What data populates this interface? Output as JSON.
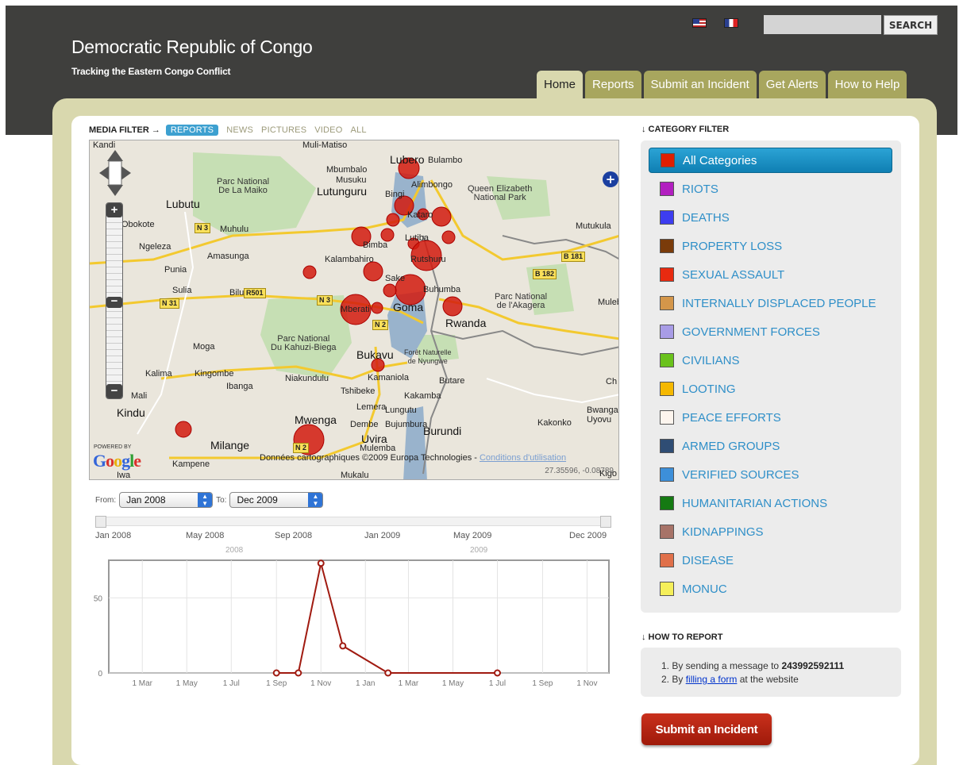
{
  "header": {
    "title": "Democratic Republic of Congo",
    "tagline": "Tracking the Eastern Congo Conflict",
    "flags": [
      "us-flag-icon",
      "france-flag-icon"
    ],
    "search_placeholder": "",
    "search_button": "SEARCH"
  },
  "nav": {
    "tabs": [
      {
        "label": "Home",
        "active": true
      },
      {
        "label": "Reports",
        "active": false
      },
      {
        "label": "Submit an Incident",
        "active": false
      },
      {
        "label": "Get Alerts",
        "active": false
      },
      {
        "label": "How to Help",
        "active": false
      }
    ]
  },
  "media_filter": {
    "label": "MEDIA FILTER →",
    "items": [
      "REPORTS",
      "NEWS",
      "PICTURES",
      "VIDEO",
      "ALL"
    ],
    "active": "REPORTS"
  },
  "map": {
    "places": [
      "Kandi",
      "Muli-Matiso",
      "Lubero",
      "Bulambo",
      "Mbumbalo",
      "Musuku",
      "Alimbongo",
      "Lutunguru",
      "Bingi",
      "Lubutu",
      "Obokote",
      "Muhulu",
      "Kataro",
      "Ngeleza",
      "Amasunga",
      "Lutiba",
      "Bimba",
      "Rutshuru",
      "Mutukula",
      "Kalambahiro",
      "Punia",
      "Sake",
      "Buhumba",
      "Sulia",
      "Bilu",
      "Mberati",
      "Goma",
      "Rwanda",
      "Moga",
      "Bukavu",
      "Kalima",
      "Kingombe",
      "Niakundulu",
      "Kamaniola",
      "Butare",
      "Ibanga",
      "Tshibeke",
      "Kakamba",
      "Mali",
      "Lemera",
      "Lungutu",
      "Kindu",
      "Mwenga",
      "Dembe",
      "Bujumbura",
      "Burundi",
      "Kakonko",
      "Bwanga",
      "Uyovu",
      "Milange",
      "Uvira",
      "Kampene",
      "Mukalu",
      "Mulemba",
      "Muleb",
      "Iwa",
      "Kigo",
      "Ch"
    ],
    "parks": [
      "Parc National\nDe La Maiko",
      "Queen Elizabeth\nNational Park",
      "Parc National\nDu Kahuzi-Biega",
      "Parc National\nde l'Akagera",
      "Forêt Naturelle\nde Nyungwe"
    ],
    "roads": [
      "N 3",
      "N 31",
      "R501",
      "N 3",
      "N 2",
      "N 2",
      "B 181",
      "B 182"
    ],
    "powered_by": "POWERED BY",
    "google_logo": "Google",
    "attribution": "Données cartographiques ©2009 Europa Technologies -",
    "conditions_link": "Conditions d'utilisation",
    "coordinates": "27.35596, -0.08789",
    "incident_color": "#d21a0e"
  },
  "timeline": {
    "from_label": "From:",
    "to_label": "To:",
    "from_value": "Jan 2008",
    "to_value": "Dec 2009",
    "slider_labels": [
      "Jan 2008",
      "May 2008",
      "Sep 2008",
      "Jan 2009",
      "May 2009",
      "Dec 2009"
    ],
    "year_labels": [
      "2008",
      "2009"
    ]
  },
  "chart_data": {
    "type": "line",
    "title": "",
    "xlabel": "",
    "ylabel": "",
    "x_tick_labels": [
      "1 Mar",
      "1 May",
      "1 Jul",
      "1 Sep",
      "1 Nov",
      "1 Jan",
      "1 Mar",
      "1 May",
      "1 Jul",
      "1 Sep",
      "1 Nov"
    ],
    "y_ticks": [
      0,
      50
    ],
    "ylim": [
      0,
      75
    ],
    "series": [
      {
        "color": "#a01a10",
        "points": [
          {
            "x": "2008-09-01",
            "y": 0
          },
          {
            "x": "2008-10-01",
            "y": 0
          },
          {
            "x": "2008-11-01",
            "y": 73
          },
          {
            "x": "2008-12-01",
            "y": 18
          },
          {
            "x": "2009-02-01",
            "y": 0
          },
          {
            "x": "2009-07-01",
            "y": 0
          }
        ]
      }
    ]
  },
  "category_filter": {
    "heading": "↓ CATEGORY FILTER",
    "items": [
      {
        "label": "All Categories",
        "color": "#e01e00",
        "active": true
      },
      {
        "label": "RIOTS",
        "color": "#b21fc0"
      },
      {
        "label": "DEATHS",
        "color": "#3d3df0"
      },
      {
        "label": "PROPERTY LOSS",
        "color": "#7a3b0a"
      },
      {
        "label": "SEXUAL ASSAULT",
        "color": "#e82a10"
      },
      {
        "label": "INTERNALLY DISPLACED PEOPLE",
        "color": "#d4964a"
      },
      {
        "label": "GOVERNMENT FORCES",
        "color": "#a89ce6"
      },
      {
        "label": "CIVILIANS",
        "color": "#6ac21c"
      },
      {
        "label": "LOOTING",
        "color": "#f5b800"
      },
      {
        "label": "PEACE EFFORTS",
        "color": "#fdf5ee"
      },
      {
        "label": "ARMED GROUPS",
        "color": "#2f4d74"
      },
      {
        "label": "VERIFIED SOURCES",
        "color": "#3d8fd9"
      },
      {
        "label": "HUMANITARIAN ACTIONS",
        "color": "#157a12"
      },
      {
        "label": "KIDNAPPINGS",
        "color": "#a77368"
      },
      {
        "label": "DISEASE",
        "color": "#e0704a"
      },
      {
        "label": "MONUC",
        "color": "#f5ef5a"
      }
    ]
  },
  "how_to_report": {
    "heading": "↓ HOW TO REPORT",
    "line1_prefix": "1.  By sending a message to ",
    "line1_number": "243992592111",
    "line2_prefix": "2.  By ",
    "line2_link": "filling a form",
    "line2_suffix": " at the website"
  },
  "submit_button": "Submit an Incident"
}
